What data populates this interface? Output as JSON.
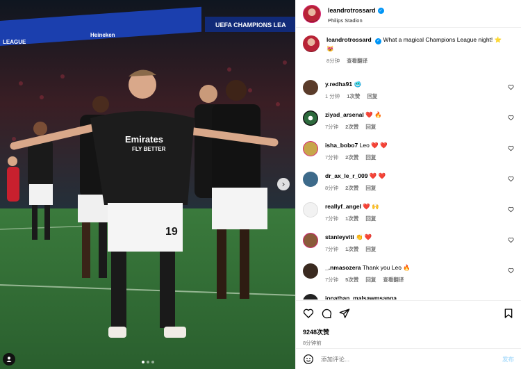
{
  "post": {
    "username": "leandrotrossard",
    "location": "Philips Stadion",
    "caption": "What a magical Champions League night! ⭐",
    "caption_emoji": "😻",
    "caption_time": "8分钟",
    "see_translation": "查看翻译"
  },
  "banner": {
    "left": "LEAGUE",
    "mid": "Heineken",
    "right": "UEFA CHAMPIONS LEA"
  },
  "comments": [
    {
      "user": "y.redha91",
      "text": "🥶",
      "time": "1 分钟",
      "likes": "1次赞",
      "reply": "回复",
      "avatar_color": "#5a3b2a"
    },
    {
      "user": "ziyad_arsenal",
      "text": "❤️ 🔥",
      "time": "7分钟",
      "likes": "2次赞",
      "reply": "回复",
      "avatar_color": "#2d6a3d"
    },
    {
      "user": "isha_bobo7",
      "text": "Leo ❤️ ❤️",
      "time": "7分钟",
      "likes": "2次赞",
      "reply": "回复",
      "avatar_color": "#c7a64a"
    },
    {
      "user": "dr_ax_le_r_009",
      "text": "❤️ ❤️",
      "time": "8分钟",
      "likes": "2次赞",
      "reply": "回复",
      "avatar_color": "#3d6a8a"
    },
    {
      "user": "reallyf_angel",
      "text": "❤️ 🙌",
      "time": "7分钟",
      "likes": "1次赞",
      "reply": "回复",
      "avatar_color": "#e8e8e8"
    },
    {
      "user": "stanleyviti",
      "text": "👏 ❤️",
      "time": "7分钟",
      "likes": "1次赞",
      "reply": "回复",
      "avatar_color": "#8a5b3a"
    },
    {
      "user": "_.nmasozera",
      "text": "Thank you Leo 🔥",
      "time": "7分钟",
      "likes": "5次赞",
      "reply": "回复",
      "translate": "查看翻译",
      "avatar_color": "#3a2a20"
    },
    {
      "user": "jonathan_malsawmsanga",
      "text": "",
      "time": "",
      "likes": "",
      "reply": "",
      "avatar_color": "#222"
    }
  ],
  "footer": {
    "likes": "9248次赞",
    "time": "8分钟前",
    "placeholder": "添加评论...",
    "post_label": "发布"
  },
  "colors": {
    "verified": "#0095f6",
    "heart": "#e0245e",
    "meta": "#737373",
    "arsenal_kit": "#1a1a1a"
  }
}
